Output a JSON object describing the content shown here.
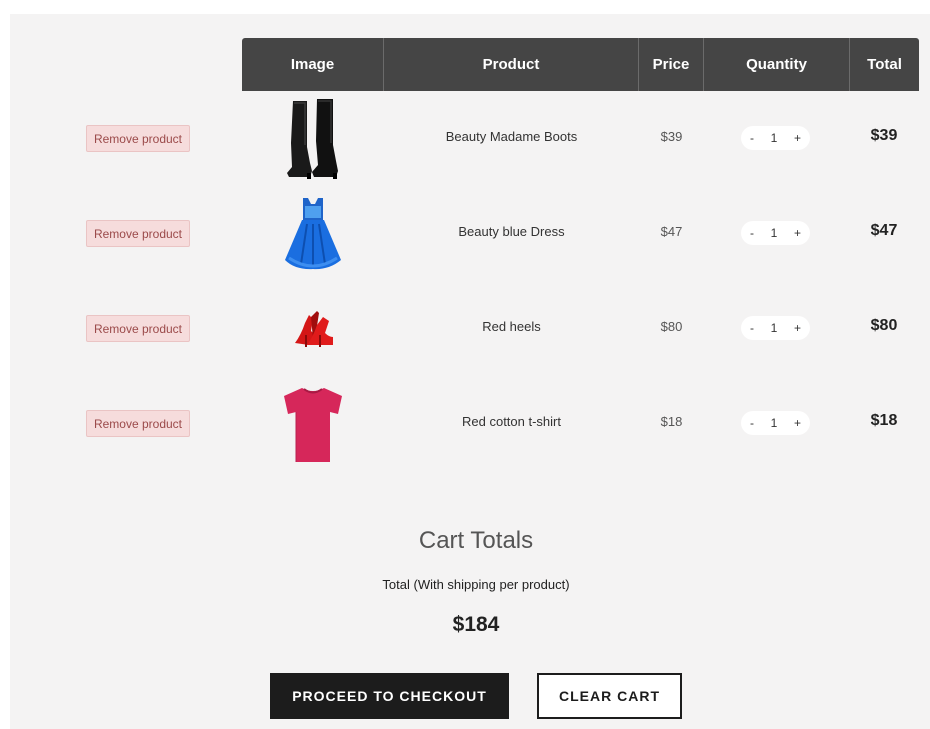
{
  "table": {
    "headers": {
      "image": "Image",
      "product": "Product",
      "price": "Price",
      "quantity": "Quantity",
      "total": "Total"
    },
    "rows": [
      {
        "remove_label": "Remove product",
        "image_icon": "boots-image",
        "product": "Beauty Madame Boots",
        "price": "$39",
        "qty_minus": "-",
        "qty": "1",
        "qty_plus": "+",
        "total": "$39"
      },
      {
        "remove_label": "Remove product",
        "image_icon": "dress-image",
        "product": "Beauty blue Dress",
        "price": "$47",
        "qty_minus": "-",
        "qty": "1",
        "qty_plus": "+",
        "total": "$47"
      },
      {
        "remove_label": "Remove product",
        "image_icon": "heels-image",
        "product": "Red heels",
        "price": "$80",
        "qty_minus": "-",
        "qty": "1",
        "qty_plus": "+",
        "total": "$80"
      },
      {
        "remove_label": "Remove product",
        "image_icon": "tshirt-image",
        "product": "Red cotton t-shirt",
        "price": "$18",
        "qty_minus": "-",
        "qty": "1",
        "qty_plus": "+",
        "total": "$18"
      }
    ]
  },
  "totals": {
    "title": "Cart Totals",
    "label": "Total (With shipping per product)",
    "value": "$184"
  },
  "actions": {
    "checkout_label": "PROCEED TO CHECKOUT",
    "clear_label": "CLEAR CART"
  },
  "colors": {
    "header_bg": "#454545",
    "panel_bg": "#f4f3f3",
    "remove_bg": "#f6dcdc",
    "remove_text": "#9b4a4a",
    "primary_button": "#1c1c1c"
  }
}
